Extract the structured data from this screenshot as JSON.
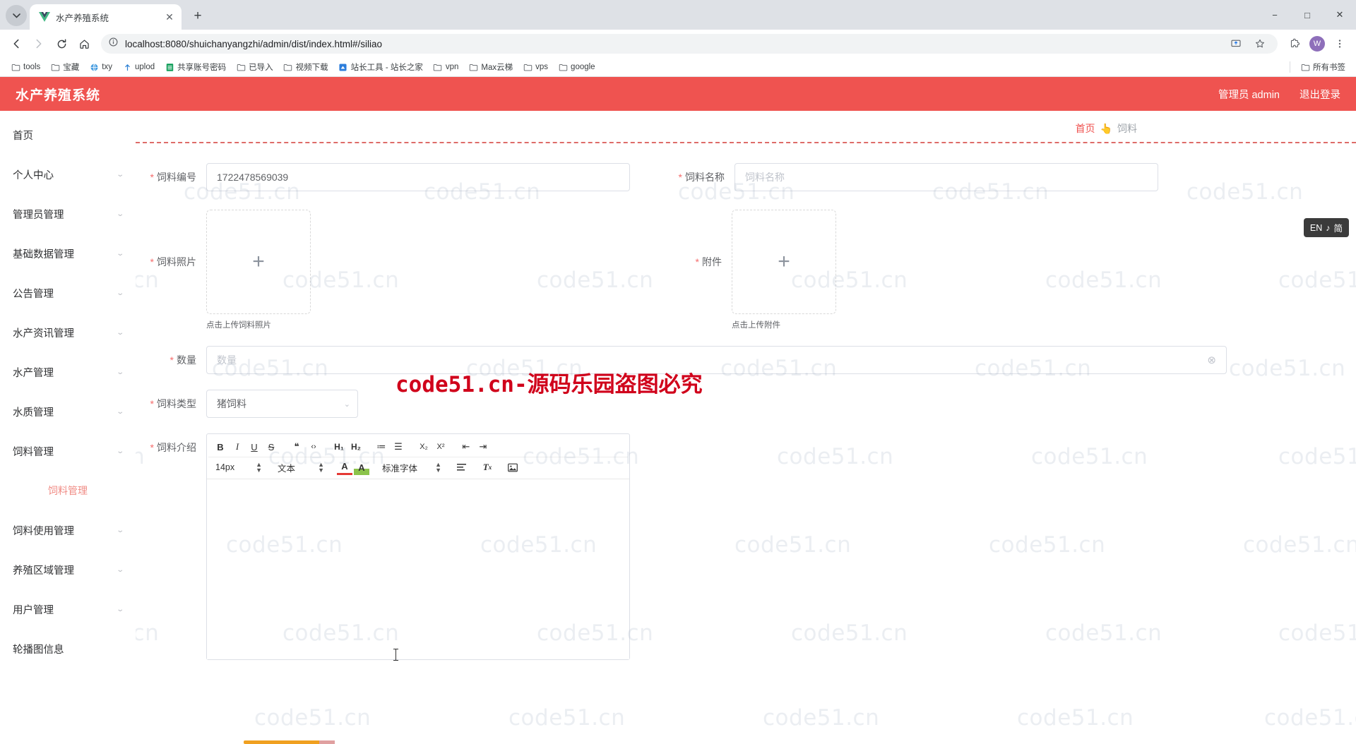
{
  "browser": {
    "tab": {
      "title": "水产养殖系统",
      "favicon": "vue-logo-icon"
    },
    "newtab_label": "+",
    "nav": {
      "back": "back-arrow-icon",
      "forward": "forward-arrow-icon",
      "reload": "reload-icon",
      "home": "home-icon"
    },
    "omnibox": {
      "info_icon": "site-info-icon",
      "url": "localhost:8080/shuichanyangzhi/admin/dist/index.html#/siliao",
      "share_icon": "share-screen-icon",
      "star_icon": "bookmark-star-icon",
      "extensions_icon": "extensions-puzzle-icon",
      "profile_initial": "W",
      "menu_icon": "three-dot-menu-icon"
    },
    "window": {
      "minimize": "−",
      "maximize": "□",
      "close": "✕"
    },
    "bookmarks": [
      {
        "label": "tools",
        "icon": "folder-icon"
      },
      {
        "label": "宝藏",
        "icon": "folder-icon"
      },
      {
        "label": "txy",
        "icon": "globe-icon"
      },
      {
        "label": "uplod",
        "icon": "upload-icon"
      },
      {
        "label": "共享账号密码",
        "icon": "sheets-icon"
      },
      {
        "label": "已导入",
        "icon": "folder-icon"
      },
      {
        "label": "视频下载",
        "icon": "folder-icon"
      },
      {
        "label": "站长工具 - 站长之家",
        "icon": "chinaz-icon"
      },
      {
        "label": "vpn",
        "icon": "folder-icon"
      },
      {
        "label": "Max云梯",
        "icon": "folder-icon"
      },
      {
        "label": "vps",
        "icon": "folder-icon"
      },
      {
        "label": "google",
        "icon": "folder-icon"
      }
    ],
    "bookmarks_overflow": {
      "label": "所有书签",
      "icon": "folder-icon"
    }
  },
  "app": {
    "logo": "水产养殖系统",
    "header_user": "管理员 admin",
    "header_logout": "退出登录",
    "sidebar": [
      {
        "label": "首页",
        "expandable": false
      },
      {
        "label": "个人中心",
        "expandable": true
      },
      {
        "label": "管理员管理",
        "expandable": true
      },
      {
        "label": "基础数据管理",
        "expandable": true
      },
      {
        "label": "公告管理",
        "expandable": true
      },
      {
        "label": "水产资讯管理",
        "expandable": true
      },
      {
        "label": "水产管理",
        "expandable": true
      },
      {
        "label": "水质管理",
        "expandable": true
      },
      {
        "label": "饲料管理",
        "expandable": true
      },
      {
        "label": "饲料使用管理",
        "expandable": true
      },
      {
        "label": "养殖区域管理",
        "expandable": true
      },
      {
        "label": "用户管理",
        "expandable": true
      },
      {
        "label": "轮播图信息",
        "expandable": false
      }
    ],
    "sidebar_active_sub": "饲料管理",
    "breadcrumb": {
      "home": "首页",
      "icon": "pointing-hand-icon",
      "current": "饲料"
    },
    "form": {
      "fields": {
        "code": {
          "label": "饲料编号",
          "required": true,
          "value": "1722478569039"
        },
        "name": {
          "label": "饲料名称",
          "required": true,
          "value": "",
          "placeholder": "饲料名称"
        },
        "photo": {
          "label": "饲料照片",
          "required": true,
          "plus": "+",
          "hint": "点击上传饲料照片"
        },
        "attachment": {
          "label": "附件",
          "required": true,
          "plus": "+",
          "hint": "点击上传附件"
        },
        "quantity": {
          "label": "数量",
          "required": true,
          "value": "",
          "placeholder": "数量"
        },
        "type": {
          "label": "饲料类型",
          "required": true,
          "value": "猪饲料"
        },
        "intro": {
          "label": "饲料介绍",
          "required": true,
          "value": ""
        }
      }
    },
    "editor": {
      "row1": [
        {
          "name": "bold-icon",
          "glyph": "B"
        },
        {
          "name": "italic-icon",
          "glyph": "I"
        },
        {
          "name": "underline-icon",
          "glyph": "U"
        },
        {
          "name": "strikethrough-icon",
          "glyph": "S"
        },
        {
          "name": "blockquote-icon",
          "glyph": "❝"
        },
        {
          "name": "code-icon",
          "glyph": "‹›"
        },
        {
          "name": "heading-1-icon",
          "glyph": "H₁"
        },
        {
          "name": "heading-2-icon",
          "glyph": "H₂"
        },
        {
          "name": "ordered-list-icon",
          "glyph": "≔"
        },
        {
          "name": "unordered-list-icon",
          "glyph": "☰"
        },
        {
          "name": "subscript-icon",
          "glyph": "X₂"
        },
        {
          "name": "superscript-icon",
          "glyph": "X²"
        },
        {
          "name": "outdent-icon",
          "glyph": "⇤"
        },
        {
          "name": "indent-icon",
          "glyph": "⇥"
        }
      ],
      "font_size": "14px",
      "text_style": "文本",
      "font_color_icon": "font-color-icon",
      "highlight_color_icon": "highlight-color-icon",
      "font_family": "标准字体",
      "align_icon": "align-left-icon",
      "clear_format_icon": "clear-format-icon",
      "image_icon": "insert-image-icon"
    }
  },
  "overlay": {
    "watermark_text": "code51.cn",
    "big_watermark": "code51.cn-源码乐园盗图必究",
    "ime": {
      "lang": "EN",
      "note": "♪",
      "mode": "简"
    }
  }
}
